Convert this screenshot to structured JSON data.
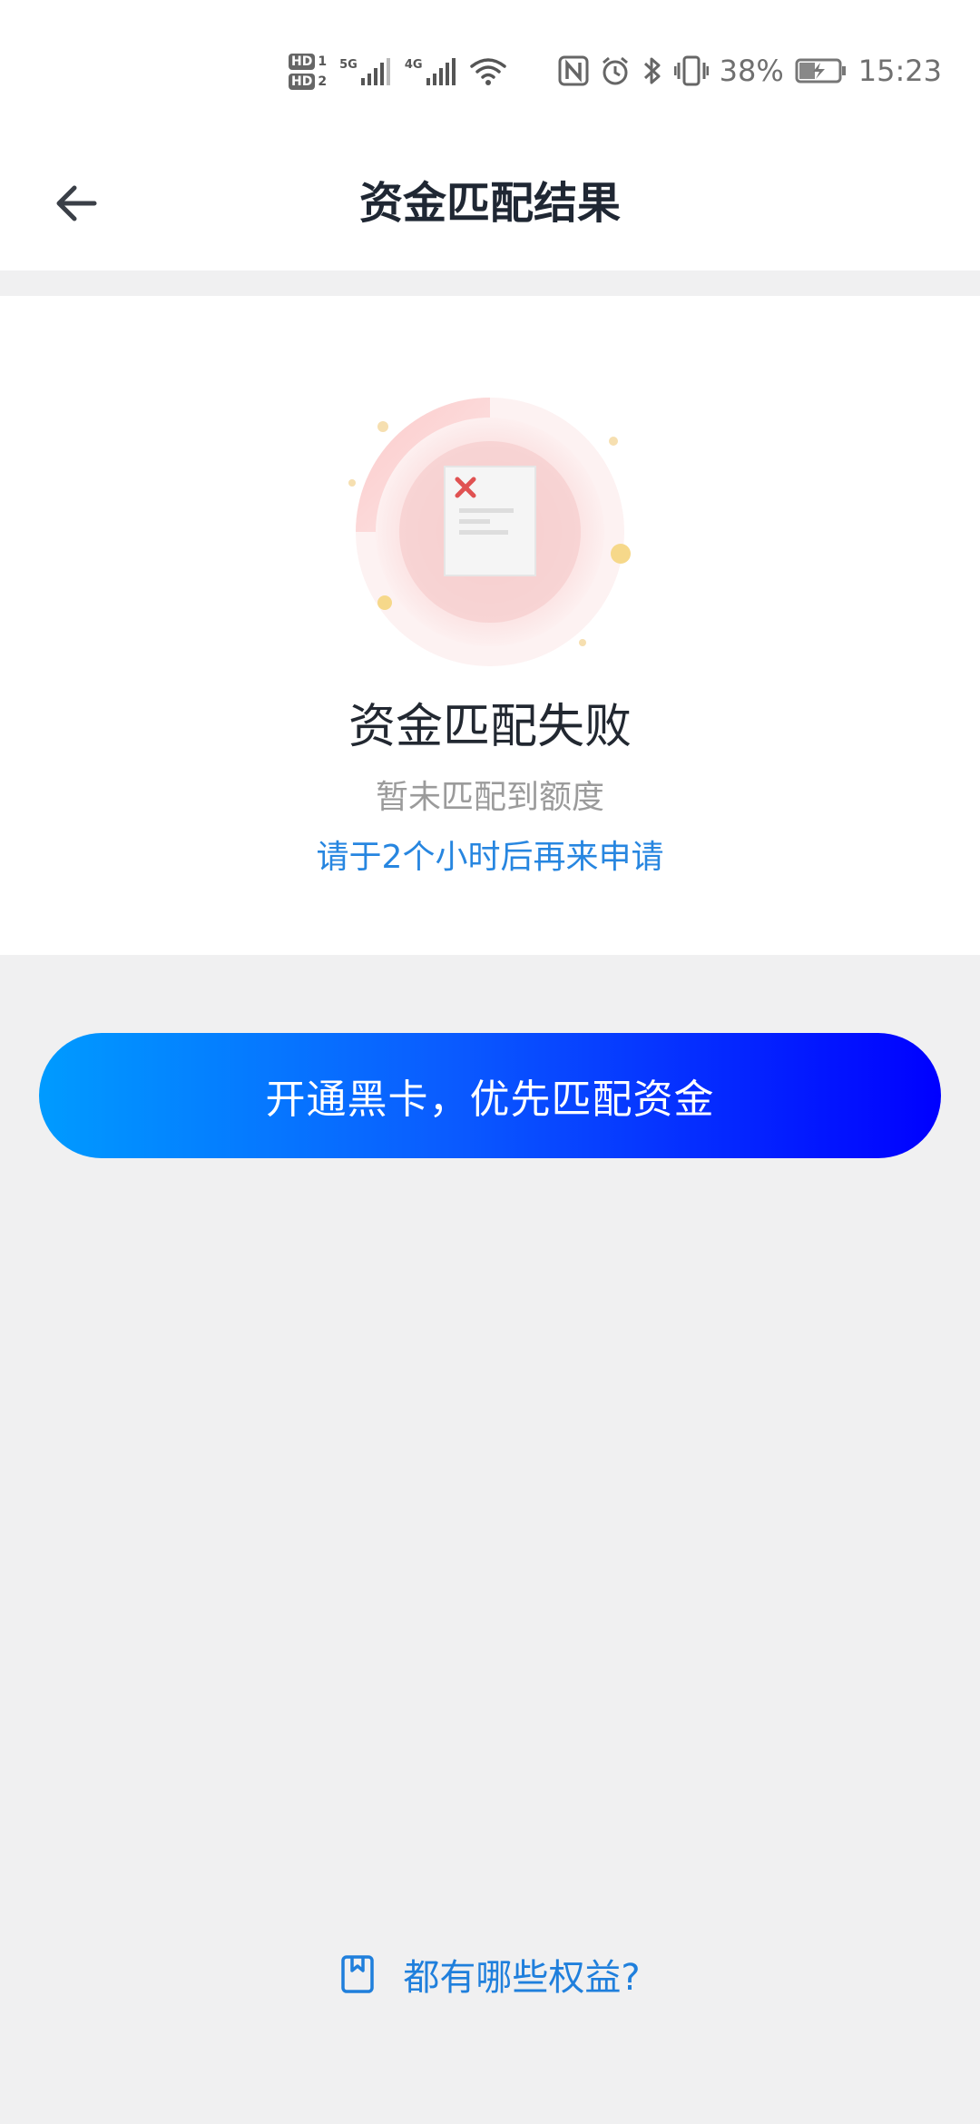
{
  "status_bar": {
    "hd1": "HD",
    "hd1_sim": "1",
    "hd2": "HD",
    "hd2_sim": "2",
    "net1": "5G",
    "net2": "4G",
    "battery_percent": "38%",
    "time": "15:23",
    "icons": [
      "nfc-icon",
      "alarm-icon",
      "bluetooth-icon",
      "vibrate-icon",
      "battery-charging-icon"
    ]
  },
  "header": {
    "title": "资金匹配结果",
    "back_icon": "arrow-left-icon"
  },
  "result": {
    "illustration_icon": "document-error-icon",
    "title": "资金匹配失败",
    "subtitle": "暂未匹配到额度",
    "hint": "请于2个小时后再来申请"
  },
  "cta": {
    "label": "开通黑卡，优先匹配资金"
  },
  "footer_link": {
    "icon": "bookmark-icon",
    "label": "都有哪些权益?"
  },
  "colors": {
    "accent_blue": "#2786e0",
    "cta_gradient_start": "#009bff",
    "cta_gradient_end": "#0000ff",
    "error_red": "#e05252",
    "background": "#f0f0f1"
  }
}
